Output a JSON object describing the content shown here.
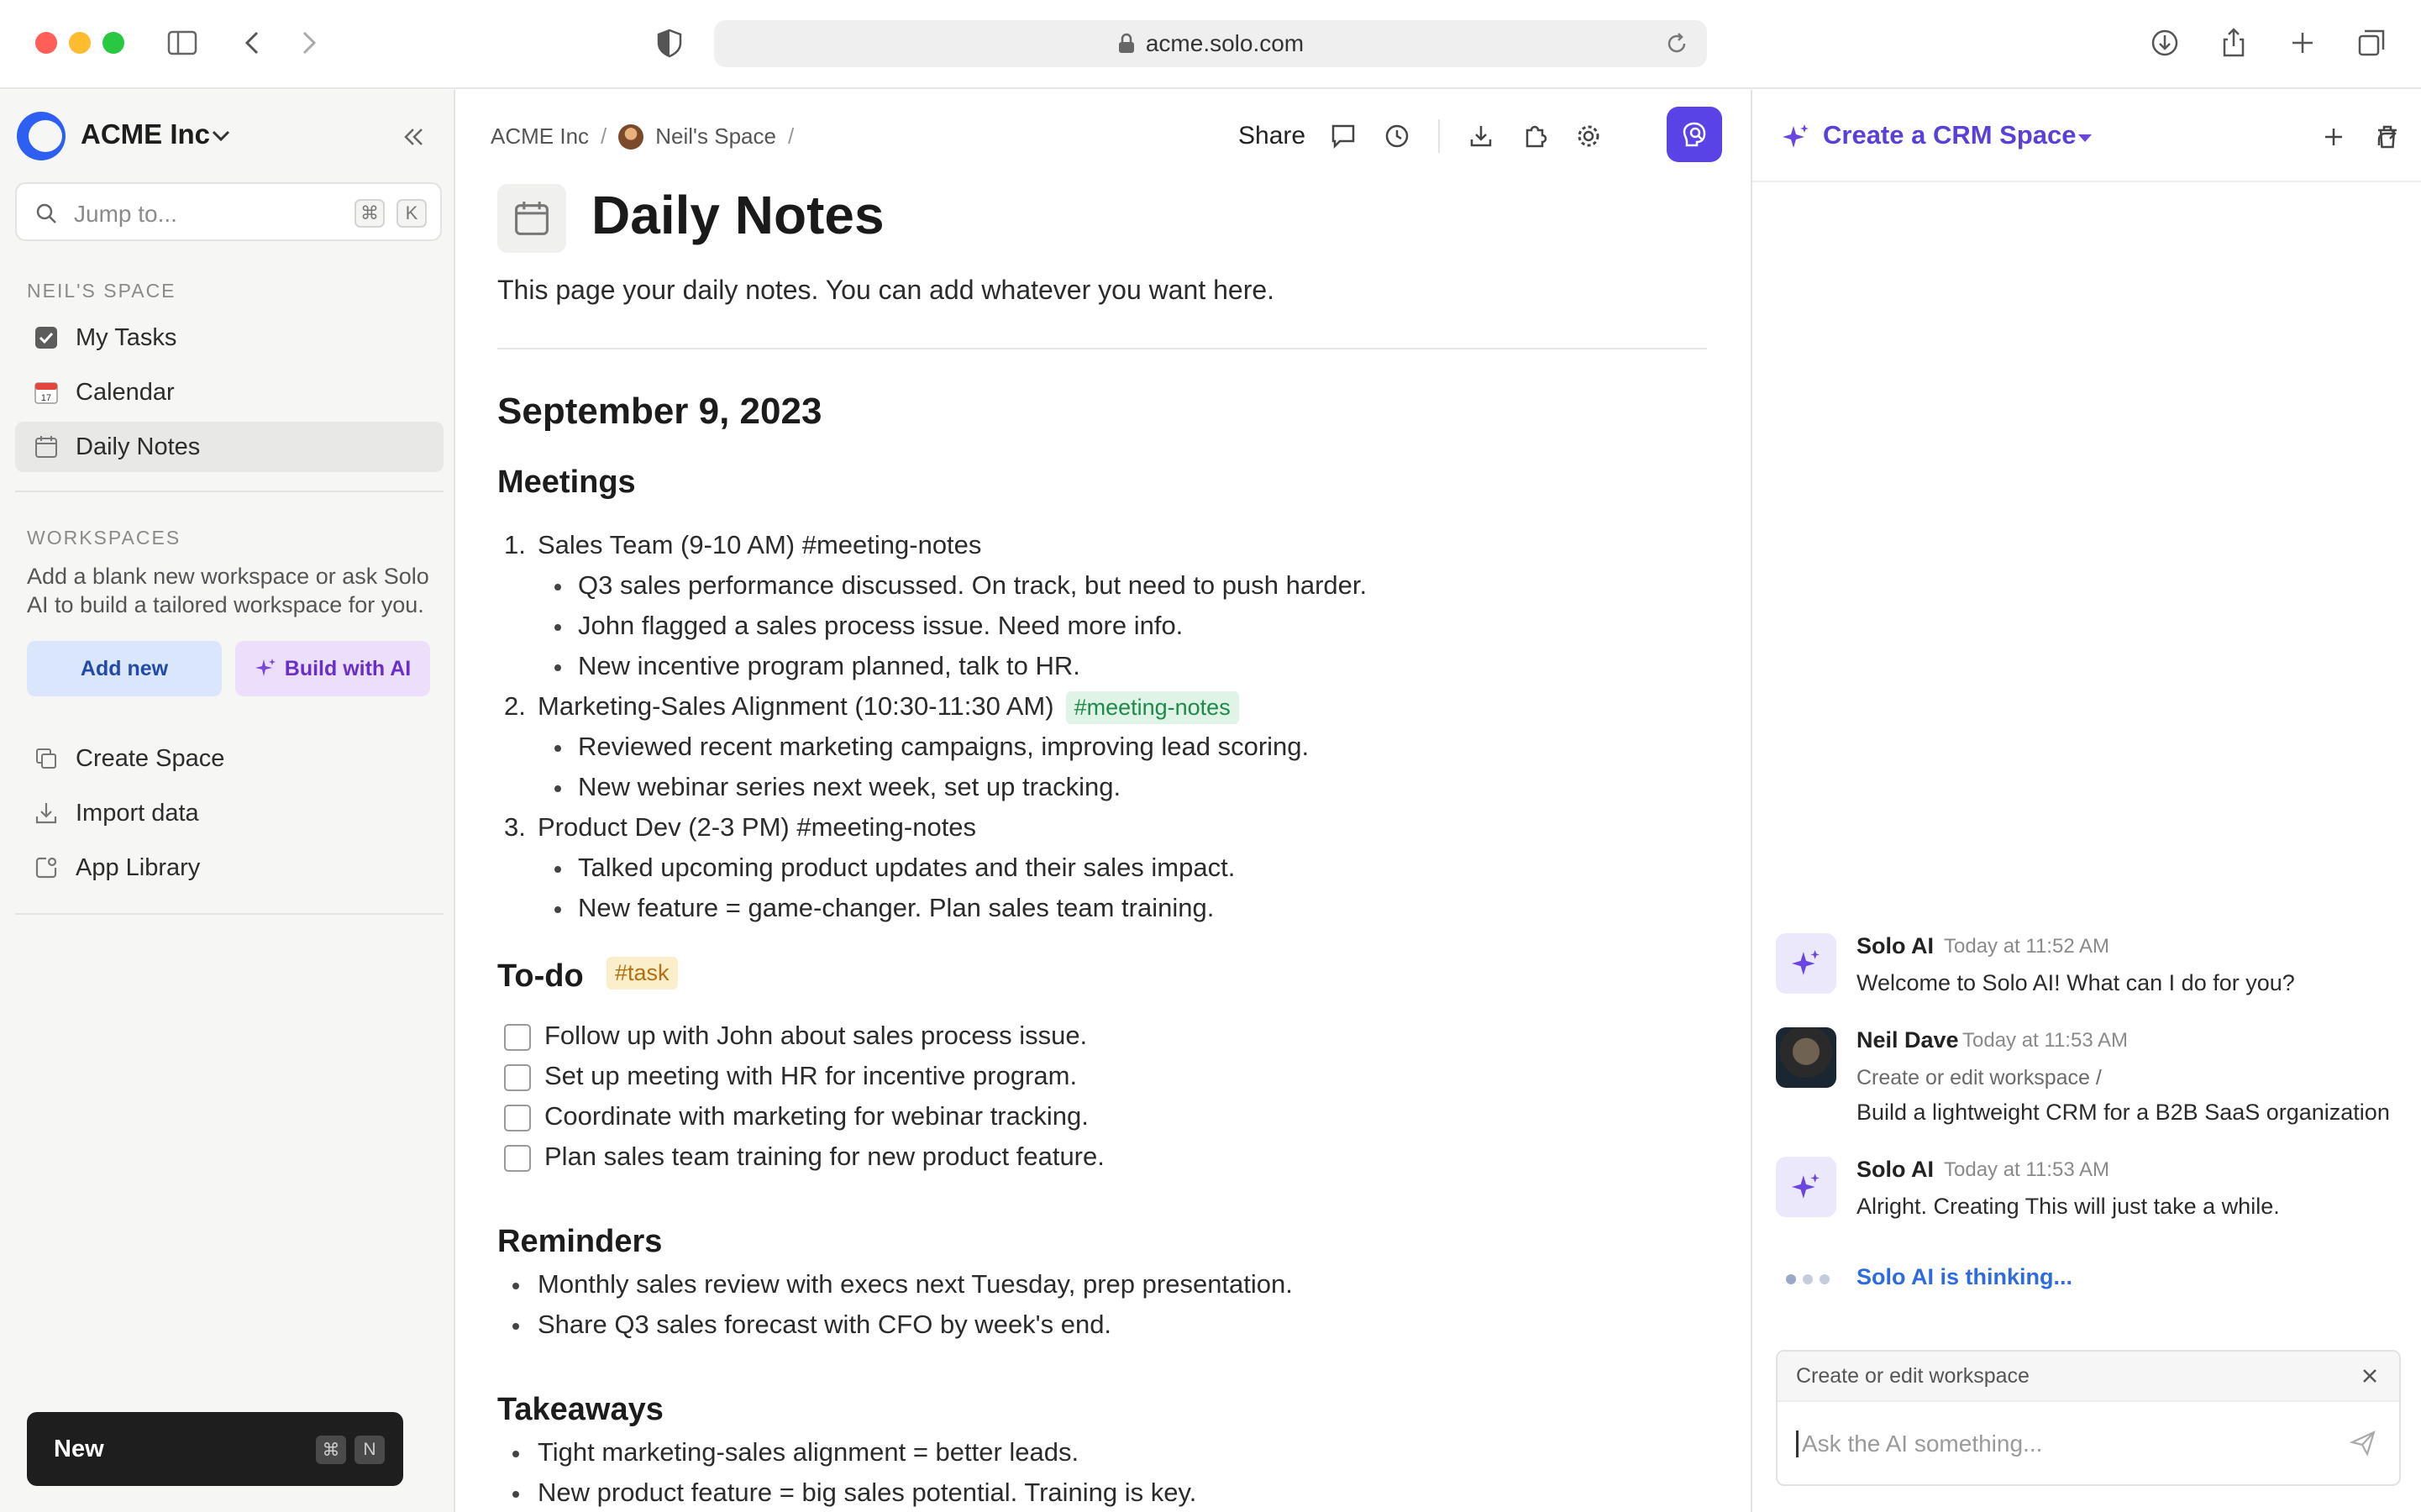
{
  "browser": {
    "url": "acme.solo.com",
    "traffic_colors": [
      "#ff5f57",
      "#febc2e",
      "#28c840"
    ]
  },
  "sidebar": {
    "workspace_name": "ACME Inc",
    "search_placeholder": "Jump to...",
    "search_shortcut": [
      "⌘",
      "K"
    ],
    "personal_section_label": "NEIL'S SPACE",
    "personal_items": [
      {
        "label": "My Tasks",
        "icon": "checkbox-icon"
      },
      {
        "label": "Calendar",
        "icon": "calendar-emoji-icon"
      },
      {
        "label": "Daily Notes",
        "icon": "calendar-icon",
        "active": true
      }
    ],
    "workspaces_label": "WORKSPACES",
    "workspaces_desc": "Add a blank new workspace or ask Solo AI to build a tailored workspace for you.",
    "add_new_label": "Add new",
    "build_ai_label": "Build with AI",
    "actions": [
      {
        "label": "Create Space",
        "icon": "copy-icon"
      },
      {
        "label": "Import data",
        "icon": "download-icon"
      },
      {
        "label": "App Library",
        "icon": "app-library-icon"
      }
    ],
    "new_label": "New",
    "new_shortcut": [
      "⌘",
      "N"
    ]
  },
  "main": {
    "breadcrumb": [
      "ACME Inc",
      "Neil's Space"
    ],
    "share_label": "Share",
    "title": "Daily Notes",
    "description": "This page your daily notes. You can add whatever you want here.",
    "date_heading": "September 9, 2023",
    "meetings_heading": "Meetings",
    "meetings": [
      {
        "num": "1.",
        "title": "Sales Team (9-10 AM) #meeting-notes",
        "tag": "",
        "bullets": [
          "Q3 sales performance discussed. On track, but need to push harder.",
          "John flagged a sales process issue. Need more info.",
          "New incentive program planned, talk to HR."
        ]
      },
      {
        "num": "2.",
        "title": "Marketing-Sales Alignment (10:30-11:30 AM)",
        "tag": "#meeting-notes",
        "bullets": [
          "Reviewed recent marketing campaigns, improving lead scoring.",
          "New webinar series next week, set up tracking."
        ]
      },
      {
        "num": "3.",
        "title": "Product Dev (2-3 PM) #meeting-notes",
        "tag": "",
        "bullets": [
          "Talked upcoming product updates and their sales impact.",
          "New feature = game-changer. Plan sales team training."
        ]
      }
    ],
    "todo_heading": "To-do",
    "todo_tag": "#task",
    "todos": [
      {
        "label": "Follow up with John about sales process issue.",
        "checked": false
      },
      {
        "label": "Set up meeting with HR for incentive program.",
        "checked": false
      },
      {
        "label": "Coordinate with marketing for webinar tracking.",
        "checked": false
      },
      {
        "label": "Plan sales team training for new product feature.",
        "checked": false
      }
    ],
    "reminders_heading": "Reminders",
    "reminders": [
      "Monthly sales review with execs next Tuesday, prep presentation.",
      "Share Q3 sales forecast with CFO by week's end."
    ],
    "takeaways_heading": "Takeaways",
    "takeaways": [
      "Tight marketing-sales alignment = better leads.",
      "New product feature = big sales potential. Training is key."
    ]
  },
  "ai_panel": {
    "title": "Create a CRM Space",
    "accent": "#5b3fd9",
    "messages": [
      {
        "author": "Solo AI",
        "time": "Today at 11:52 AM",
        "context": "",
        "text": "Welcome to Solo AI! What can I do for you?",
        "kind": "ai"
      },
      {
        "author": "Neil Dave",
        "time": "Today at 11:53 AM",
        "context": "Create or edit workspace /",
        "text": "Build a lightweight CRM for a B2B SaaS organization",
        "kind": "user"
      },
      {
        "author": "Solo AI",
        "time": "Today at 11:53 AM",
        "context": "",
        "text": "Alright. Creating This will just take a while.",
        "kind": "ai"
      }
    ],
    "thinking": "Solo AI is thinking...",
    "composer_context": "Create or edit workspace",
    "composer_placeholder": "Ask the AI something..."
  }
}
